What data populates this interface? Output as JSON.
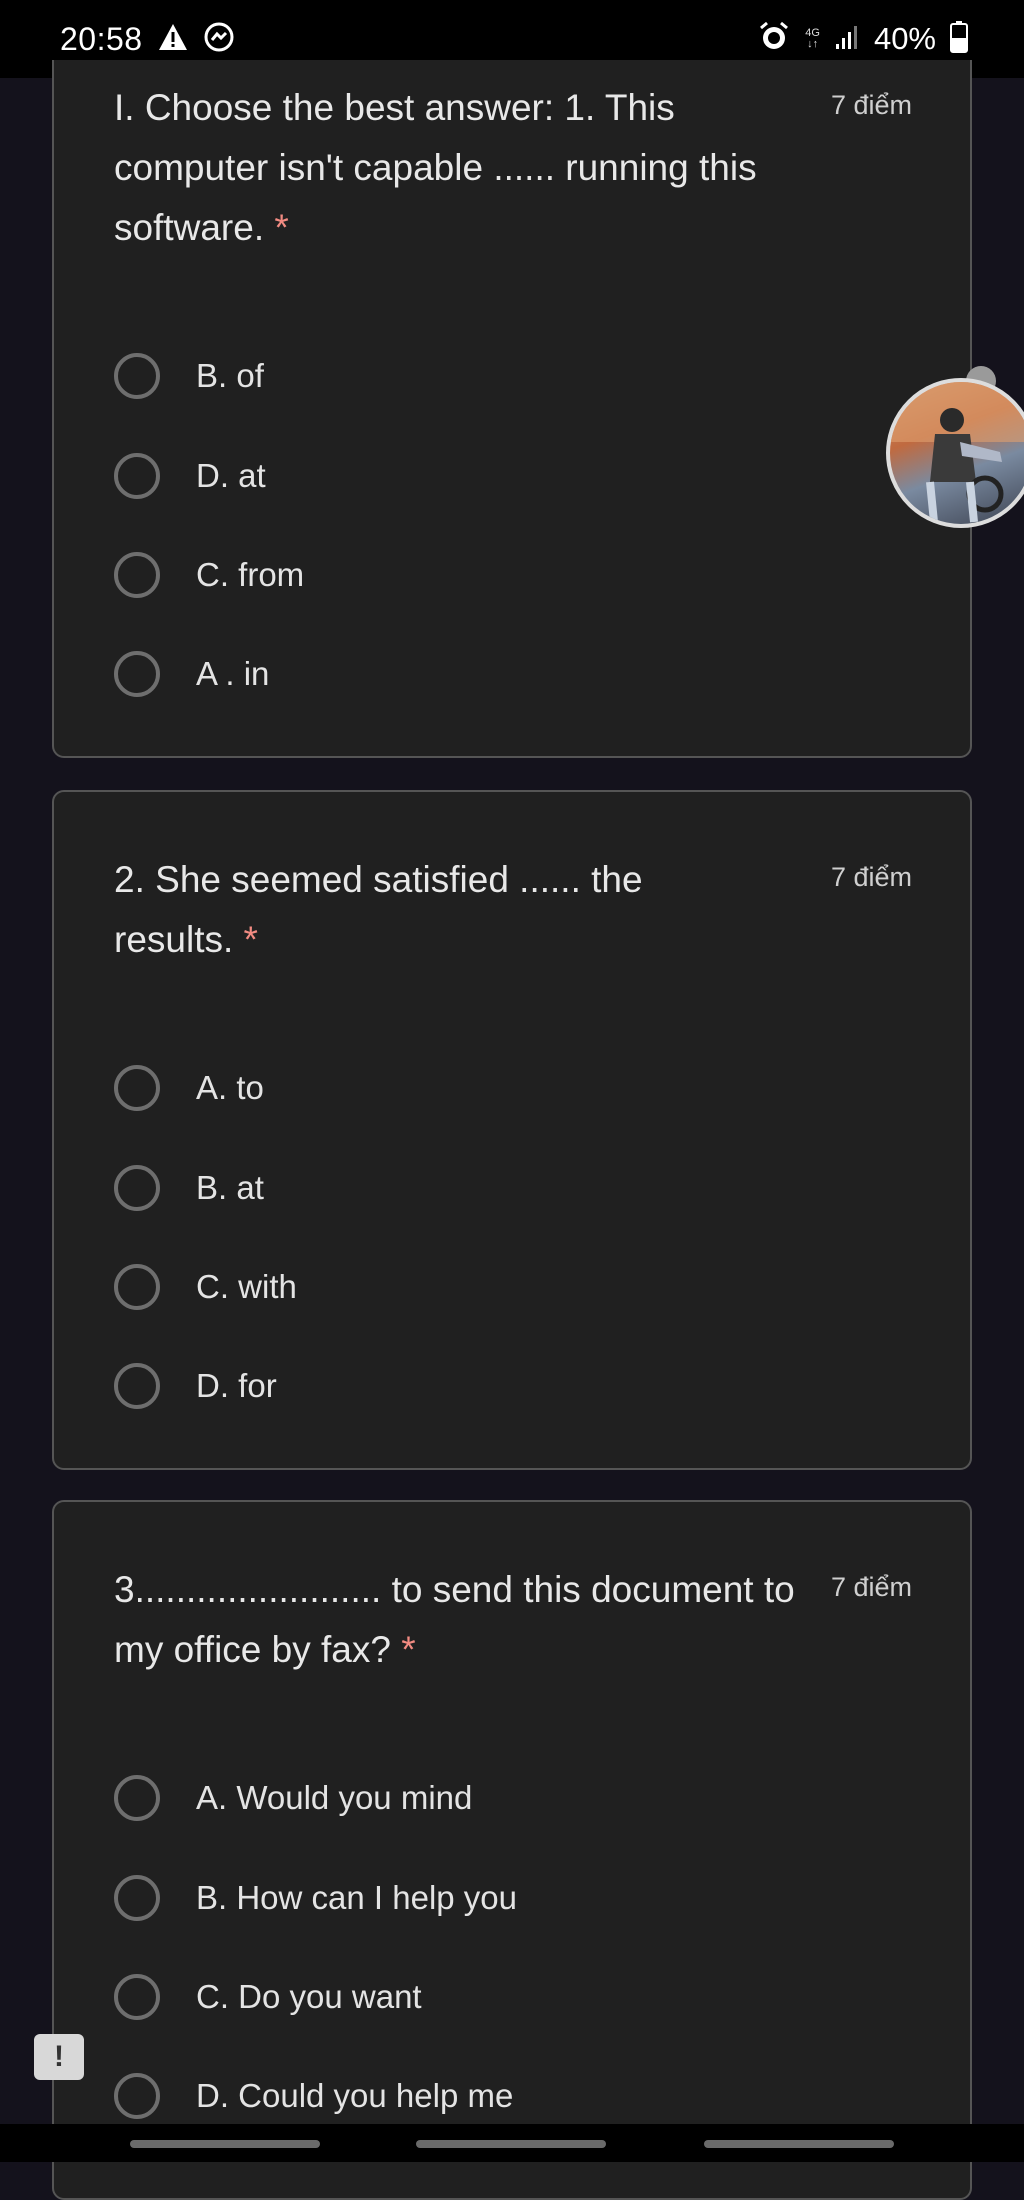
{
  "status_bar": {
    "time": "20:58",
    "network": "4G",
    "battery_percent": "40%",
    "icons": [
      "warning-icon",
      "messenger-icon",
      "alarm-icon",
      "signal-icon",
      "battery-icon"
    ]
  },
  "questions": [
    {
      "text": "I. Choose the best answer: 1. This computer isn't capable ...... running this software.",
      "required_mark": "*",
      "points": "7 điểm",
      "options": [
        "B. of",
        "D. at",
        "C. from",
        "A . in"
      ]
    },
    {
      "text": "2. She seemed satisfied ...... the results.",
      "required_mark": "*",
      "points": "7 điểm",
      "options": [
        "A. to",
        "B. at",
        "C. with",
        "D. for"
      ]
    },
    {
      "text": "3........................ to send this document to my office by fax?",
      "required_mark": "*",
      "points": "7 điểm",
      "options": [
        "A. Would you mind",
        "B. How can I help you",
        "C. Do you want",
        "D. Could you help me"
      ]
    }
  ],
  "feedback_button": {
    "glyph": "!"
  },
  "colors": {
    "background": "#14121c",
    "card": "#202020",
    "required": "#f28b82",
    "radio": "#6e6e6e"
  }
}
